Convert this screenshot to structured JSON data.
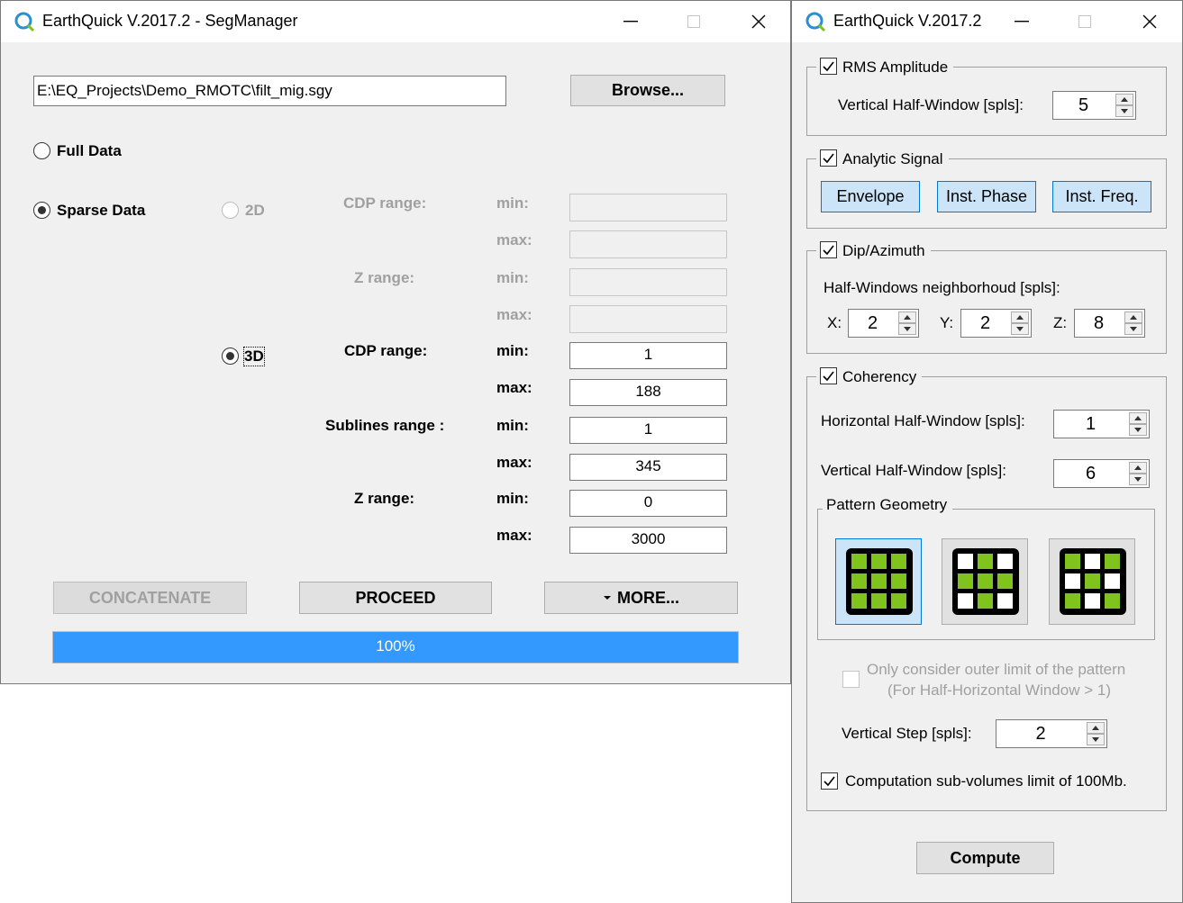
{
  "colors": {
    "accent_green": "#7fc31c",
    "progress_blue": "#3399ff",
    "selection_blue": "#cce4f7"
  },
  "segmanager": {
    "title": "EarthQuick V.2017.2 - SegManager",
    "file_path": "E:\\EQ_Projects\\Demo_RMOTC\\filt_mig.sgy",
    "browse_label": "Browse...",
    "full_data_label": "Full Data",
    "sparse_data_label": "Sparse Data",
    "mode_2d_label": "2D",
    "mode_3d_label": "3D",
    "range_2d": {
      "cdp_label": "CDP range:",
      "z_label": "Z range:",
      "min_label": "min:",
      "max_label": "max:"
    },
    "range_3d": {
      "cdp_label": "CDP range:",
      "sublines_label": "Sublines range :",
      "z_label": "Z range:",
      "min_label": "min:",
      "max_label": "max:",
      "cdp_min": "1",
      "cdp_max": "188",
      "sublines_min": "1",
      "sublines_max": "345",
      "z_min": "0",
      "z_max": "3000"
    },
    "concatenate_label": "CONCATENATE",
    "proceed_label": "PROCEED",
    "more_label": "MORE...",
    "progress_text": "100%",
    "progress_value": 1.0
  },
  "attributes": {
    "title": "EarthQuick V.2017.2",
    "rms": {
      "label": "RMS Amplitude",
      "checked": true,
      "vertical_half_window_label": "Vertical Half-Window [spls]:",
      "vertical_half_window_value": "5"
    },
    "analytic": {
      "label": "Analytic Signal",
      "checked": true,
      "envelope_label": "Envelope",
      "phase_label": "Inst. Phase",
      "freq_label": "Inst. Freq."
    },
    "dip": {
      "label": "Dip/Azimuth",
      "checked": true,
      "neighborhood_label": "Half-Windows neighborhoud [spls]:",
      "x_label": "X:",
      "x_value": "2",
      "y_label": "Y:",
      "y_value": "2",
      "z_label": "Z:",
      "z_value": "8"
    },
    "coherency": {
      "label": "Coherency",
      "checked": true,
      "horizontal_label": "Horizontal Half-Window [spls]:",
      "horizontal_value": "1",
      "vertical_label": "Vertical Half-Window [spls]:",
      "vertical_value": "6",
      "pattern_label": "Pattern Geometry",
      "outer_limit_line1": "Only consider outer limit of the pattern",
      "outer_limit_line2": "(For Half-Horizontal Window > 1)",
      "vertical_step_label": "Vertical Step [spls]:",
      "vertical_step_value": "2",
      "sub_volumes_label": "Computation sub-volumes limit of 100Mb."
    },
    "compute_label": "Compute"
  }
}
